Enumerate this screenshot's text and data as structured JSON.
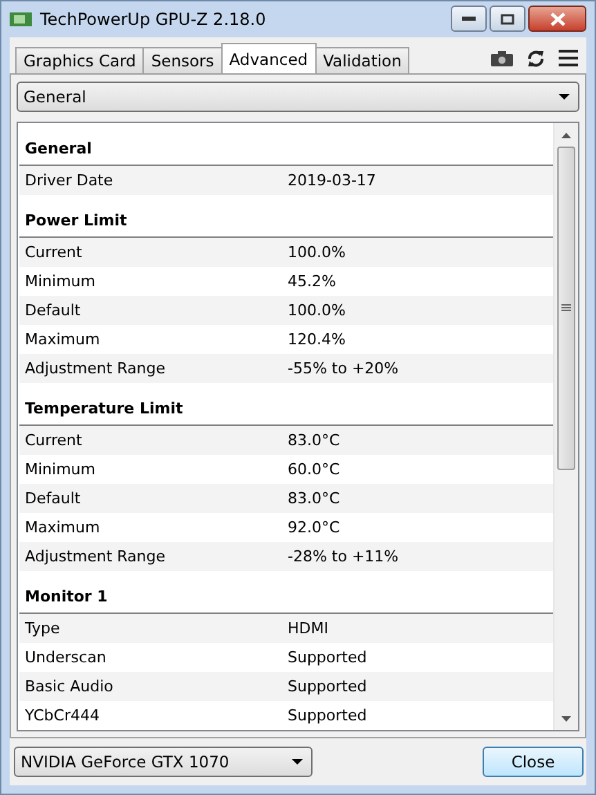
{
  "window": {
    "title": "TechPowerUp GPU-Z 2.18.0"
  },
  "tabs": [
    {
      "label": "Graphics Card",
      "selected": false
    },
    {
      "label": "Sensors",
      "selected": false
    },
    {
      "label": "Advanced",
      "selected": true
    },
    {
      "label": "Validation",
      "selected": false
    }
  ],
  "category_dropdown": {
    "value": "General"
  },
  "sections": [
    {
      "title": "General",
      "rows": [
        {
          "label": "Driver Date",
          "value": "2019-03-17"
        }
      ]
    },
    {
      "title": "Power Limit",
      "rows": [
        {
          "label": "Current",
          "value": "100.0%"
        },
        {
          "label": "Minimum",
          "value": "45.2%"
        },
        {
          "label": "Default",
          "value": "100.0%"
        },
        {
          "label": "Maximum",
          "value": "120.4%"
        },
        {
          "label": "Adjustment Range",
          "value": "-55% to +20%"
        }
      ]
    },
    {
      "title": "Temperature Limit",
      "rows": [
        {
          "label": "Current",
          "value": "83.0°C"
        },
        {
          "label": "Minimum",
          "value": "60.0°C"
        },
        {
          "label": "Default",
          "value": "83.0°C"
        },
        {
          "label": "Maximum",
          "value": "92.0°C"
        },
        {
          "label": "Adjustment Range",
          "value": "-28% to +11%"
        }
      ]
    },
    {
      "title": "Monitor 1",
      "rows": [
        {
          "label": "Type",
          "value": "HDMI"
        },
        {
          "label": "Underscan",
          "value": "Supported"
        },
        {
          "label": "Basic Audio",
          "value": "Supported"
        },
        {
          "label": "YCbCr444",
          "value": "Supported"
        }
      ]
    }
  ],
  "gpu_dropdown": {
    "value": "NVIDIA GeForce GTX 1070"
  },
  "close_button": {
    "label": "Close"
  }
}
